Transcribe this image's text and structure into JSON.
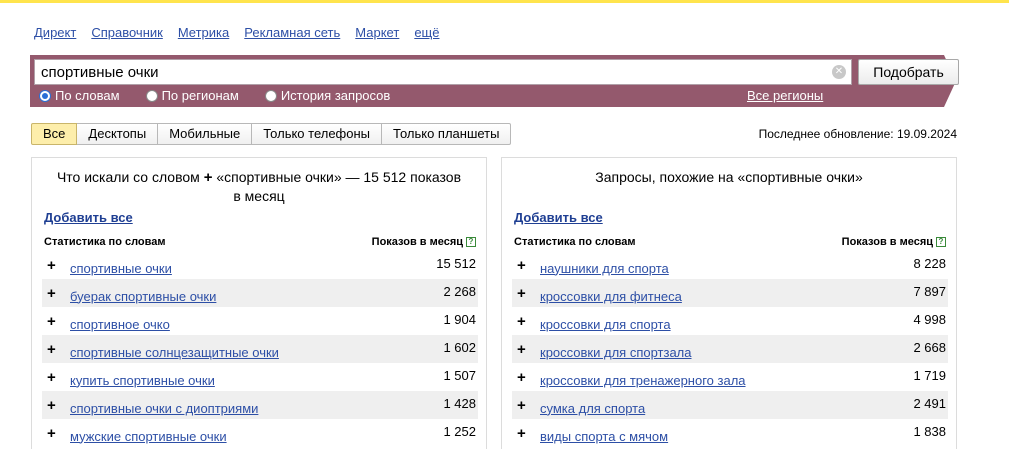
{
  "nav": [
    "Директ",
    "Справочник",
    "Метрика",
    "Рекламная сеть",
    "Маркет",
    "ещё"
  ],
  "search": {
    "value": "спортивные очки",
    "submit_label": "Подобрать",
    "radios": [
      {
        "label": "По словам",
        "checked": true
      },
      {
        "label": "По регионам",
        "checked": false
      },
      {
        "label": "История запросов",
        "checked": false
      }
    ],
    "regions_link": "Все регионы"
  },
  "tabs": [
    {
      "label": "Все",
      "active": true
    },
    {
      "label": "Десктопы",
      "active": false
    },
    {
      "label": "Мобильные",
      "active": false
    },
    {
      "label": "Только телефоны",
      "active": false
    },
    {
      "label": "Только планшеты",
      "active": false
    }
  ],
  "updated": "Последнее обновление: 19.09.2024",
  "left": {
    "title_pre": "Что искали со словом",
    "title_post": "«спортивные очки» — 15 512 показов в месяц",
    "add_all": "Добавить все",
    "col_words": "Статистика по словам",
    "col_shows": "Показов в месяц",
    "rows": [
      {
        "phrase": "спортивные очки",
        "count": "15 512"
      },
      {
        "phrase": "буерак спортивные очки",
        "count": "2 268"
      },
      {
        "phrase": "спортивное очко",
        "count": "1 904"
      },
      {
        "phrase": "спортивные солнцезащитные очки",
        "count": "1 602"
      },
      {
        "phrase": "купить спортивные очки",
        "count": "1 507"
      },
      {
        "phrase": "спортивные очки с диоптриями",
        "count": "1 428"
      },
      {
        "phrase": "мужские спортивные очки",
        "count": "1 252"
      }
    ]
  },
  "right": {
    "title": "Запросы, похожие на «спортивные очки»",
    "add_all": "Добавить все",
    "col_words": "Статистика по словам",
    "col_shows": "Показов в месяц",
    "rows": [
      {
        "phrase": "наушники для спорта",
        "count": "8 228"
      },
      {
        "phrase": "кроссовки для фитнеса",
        "count": "7 897"
      },
      {
        "phrase": "кроссовки для спорта",
        "count": "4 998"
      },
      {
        "phrase": "кроссовки для спортзала",
        "count": "2 668"
      },
      {
        "phrase": "кроссовки для тренажерного зала",
        "count": "1 719"
      },
      {
        "phrase": "сумка для спорта",
        "count": "2 491"
      },
      {
        "phrase": "виды спорта с мячом",
        "count": "1 838"
      }
    ]
  },
  "colors": {
    "accent_bar": "#94596d",
    "link": "#2d4fa6",
    "active_tab": "#fdeeab",
    "top_line": "#ffe44d"
  }
}
